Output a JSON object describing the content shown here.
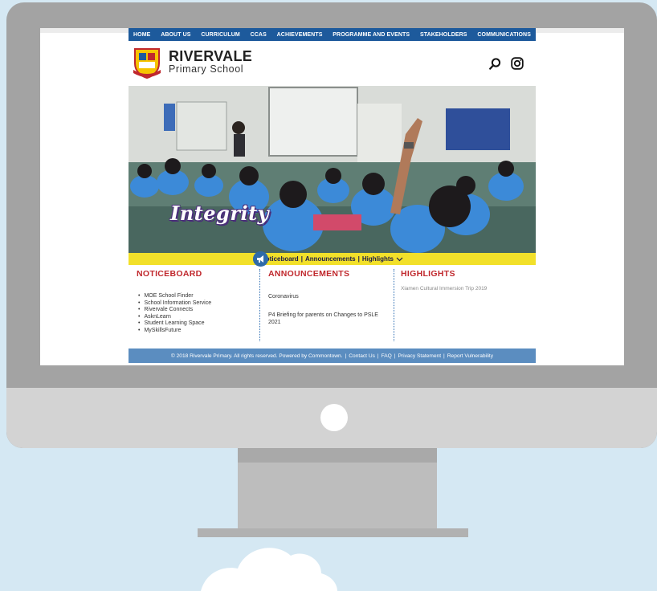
{
  "site": {
    "nav": [
      "HOME",
      "ABOUT US",
      "CURRICULUM",
      "CCAS",
      "ACHIEVEMENTS",
      "PROGRAMME AND EVENTS",
      "STAKEHOLDERS",
      "COMMUNICATIONS"
    ],
    "school_name": "RIVERVALE",
    "school_subtitle": "Primary School",
    "hero_caption": "Integrity",
    "tabbar": {
      "noticeboard": "Noticeboard",
      "announcements": "Announcements",
      "highlights": "Highlights",
      "separator": "|"
    },
    "noticeboard": {
      "title": "NOTICEBOARD",
      "items": [
        "MOE School Finder",
        "School Information Service",
        "Rivervale Connects",
        "AsknLearn",
        "Student Learning Space",
        "MySkillsFuture"
      ]
    },
    "announcements": {
      "title": "ANNOUNCEMENTS",
      "items": [
        "Coronavirus",
        "P4 Briefing for parents on Changes to PSLE 2021"
      ]
    },
    "highlights": {
      "title": "HIGHLIGHTS",
      "items": [
        "Xiamen Cultural Immersion Trip 2019"
      ]
    },
    "footer": {
      "copyright": "© 2018 Rivervale Primary. All rights reserved. Powered by Commontown.",
      "links": [
        "Contact Us",
        "FAQ",
        "Privacy Statement",
        "Report Vulnerability"
      ],
      "separator": "|"
    }
  },
  "icons": {
    "search": "search-icon",
    "instagram": "instagram-icon",
    "megaphone": "megaphone-icon",
    "chevron": "chevron-down-icon",
    "crest": "school-crest-logo"
  },
  "colors": {
    "nav_bg": "#1d5a9c",
    "accent_red": "#c0282d",
    "tab_yellow": "#f2e02a",
    "footer_bg": "#5b8dc0",
    "monitor_frame": "#a3a3a3",
    "background": "#d5e8f3"
  }
}
